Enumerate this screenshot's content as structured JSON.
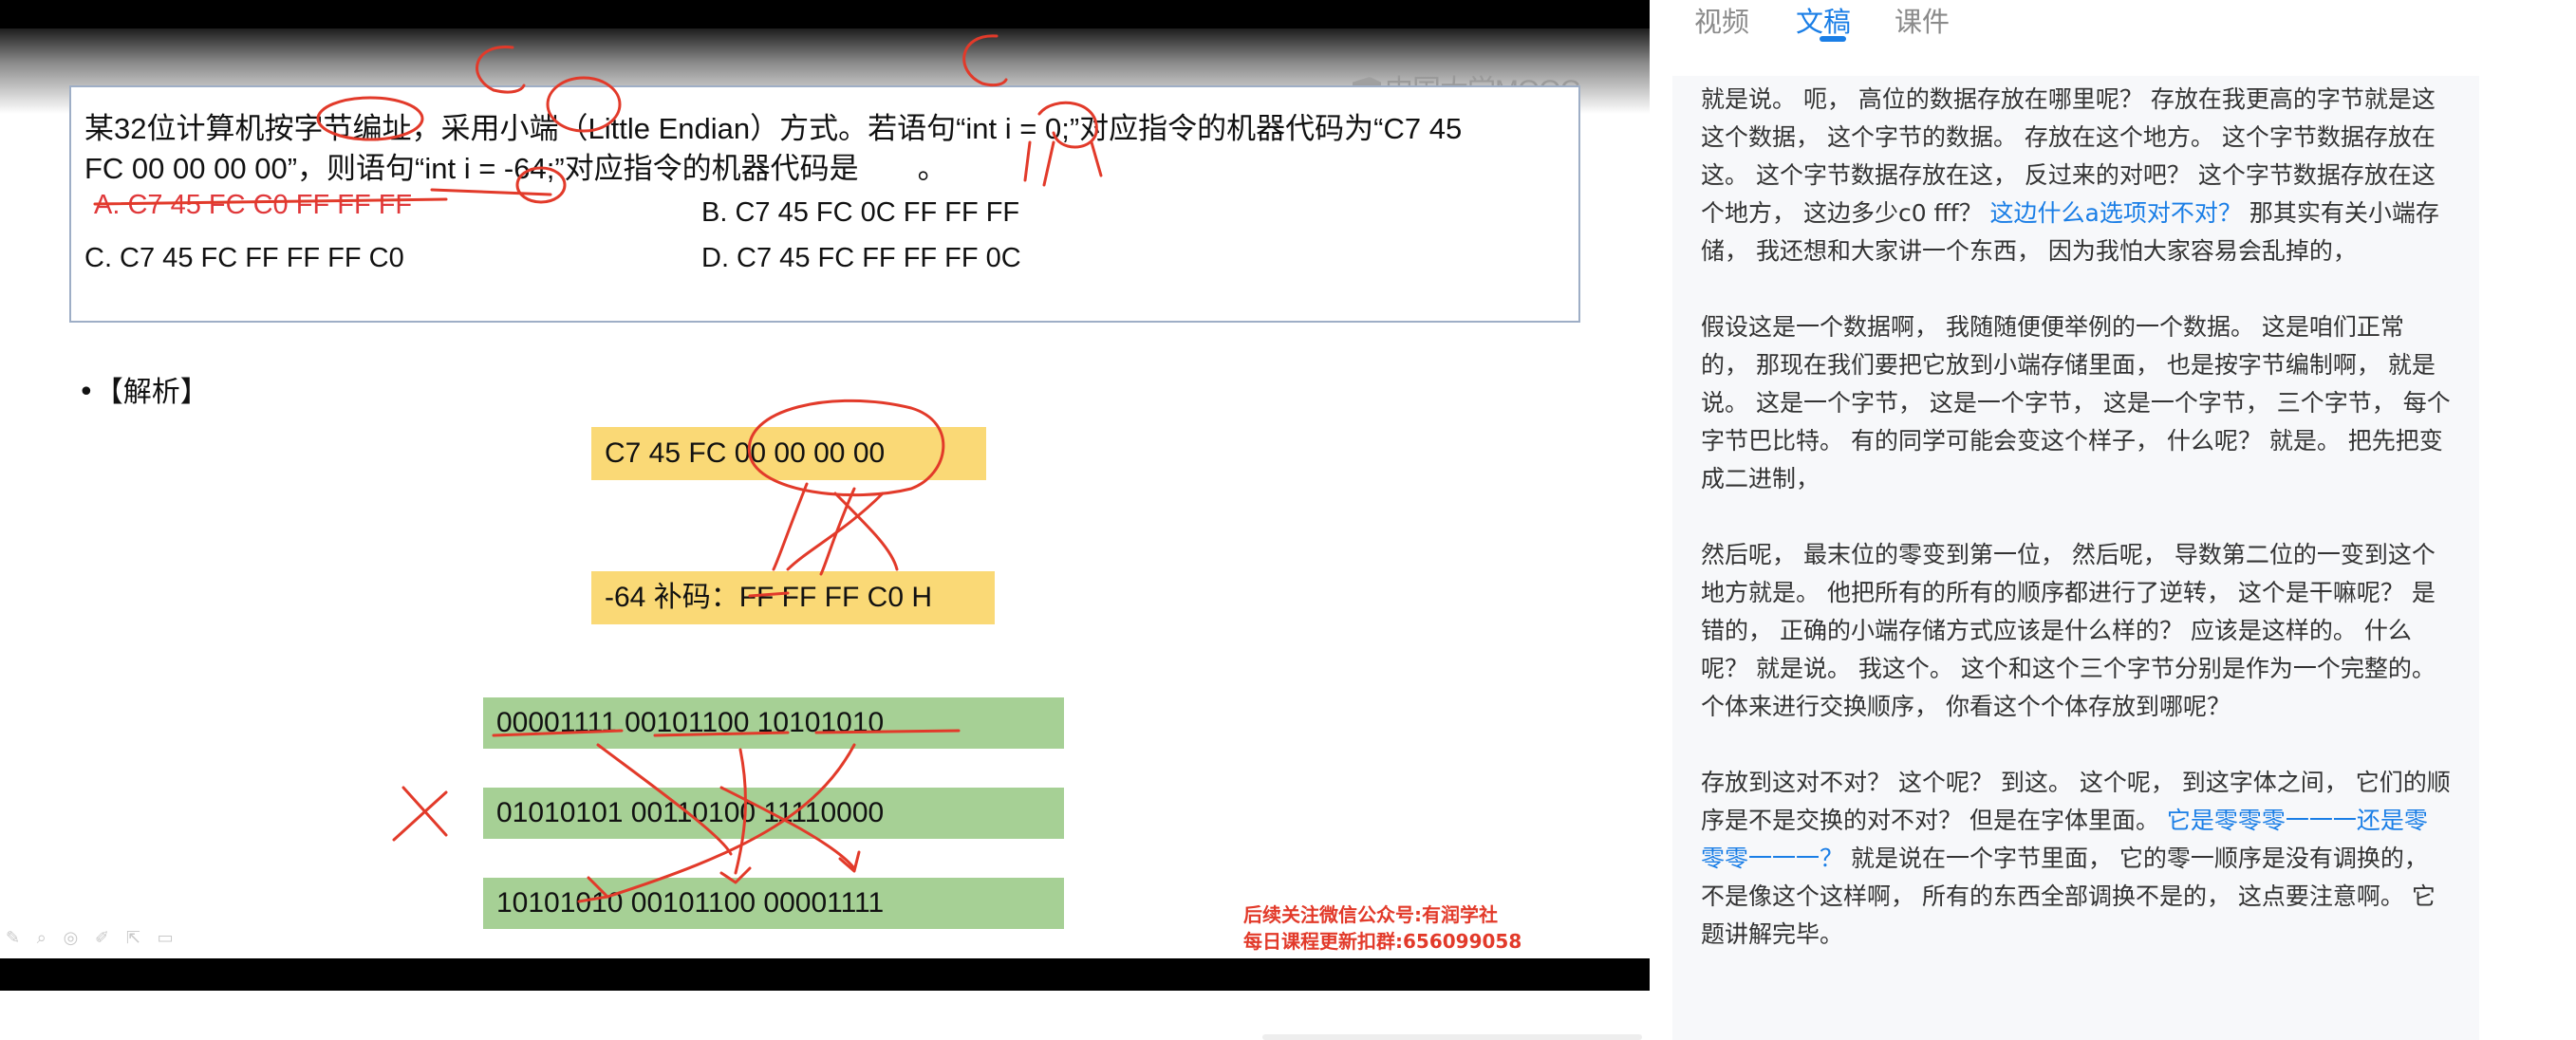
{
  "video": {
    "watermark": "中国大学MOOC",
    "question": {
      "line1": "某32位计算机按字节编址，采用小端（Little Endian）方式。若语句“int i = 0;”对应指令的机器代码为“C7 45",
      "line2": "FC 00 00 00 00”，则语句“int i = -64;”对应指令的机器代码是　　。",
      "option_a": "A. C7 45 FC C0 FF FF FF",
      "option_b": "B. C7 45 FC 0C FF FF FF",
      "option_c": "C. C7 45 FC FF FF FF C0",
      "option_d": "D. C7 45 FC FF FF FF 0C"
    },
    "analysis_title": "•【解析】",
    "instruction_code": "C7 45 FC 00 00 00 00",
    "complement_code": "-64 补码：FF FF FF C0 H",
    "binary_rows": [
      "00001111   00101100   10101010",
      "01010101   00110100  11110000",
      "10101010  00101100  00001111"
    ],
    "promo_line1": "后续关注微信公众号:有润学社",
    "promo_line2": "每日课程更新扣群:656099058",
    "controls_glyphs": "✎ ⌕ ◎ ✐ ⇱ ▭"
  },
  "tabs": {
    "video": "视频",
    "doc": "文稿",
    "courseware": "课件"
  },
  "transcript": {
    "p1": "就是说。 呃， 高位的数据存放在哪里呢？ 存放在我更高的字节就是这这个数据， 这个字节的数据。 存放在这个地方。 这个字节数据存放在这。 这个字节数据存放在这， 反过来的对吧？ 这个字节数据存放在这个地方， 这边多少c0 fff？",
    "p1_highlight": "这边什么a选项对不对？",
    "p1_tail": "那其实有关小端存储， 我还想和大家讲一个东西， 因为我怕大家容易会乱掉的，",
    "p2": "假设这是一个数据啊， 我随随便便举例的一个数据。 这是咱们正常的， 那现在我们要把它放到小端存储里面， 也是按字节编制啊， 就是说。 这是一个字节， 这是一个字节， 这是一个字节， 三个字节， 每个字节巴比特。 有的同学可能会变这个样子， 什么呢？ 就是。 把先把变成二进制，",
    "p3": "然后呢， 最末位的零变到第一位， 然后呢， 导数第二位的一变到这个地方就是。 他把所有的所有的顺序都进行了逆转， 这个是干嘛呢？ 是错的， 正确的小端存储方式应该是什么样的？ 应该是这样的。 什么呢？ 就是说。 我这个。 这个和这个三个字节分别是作为一个完整的。 个体来进行交换顺序， 你看这个个体存放到哪呢？",
    "p4": "存放到这对不对？ 这个呢？ 到这。 这个呢， 到这字体之间， 它们的顺序是不是交换的对不对？ 但是在字体里面。",
    "p4_highlight": "它是零零零一一一还是零零零一一一？",
    "p4_tail": "就是说在一个字节里面， 它的零一顺序是没有调换的， 不是像这个这样啊， 所有的东西全部调换不是的， 这点要注意啊。 它题讲解完毕。"
  },
  "colors": {
    "accent": "#1a7ee6",
    "answer_red": "#e0383a",
    "yellow_box": "#fad976",
    "green_box": "#a6d095",
    "annotation_ink": "#e23a2a"
  }
}
